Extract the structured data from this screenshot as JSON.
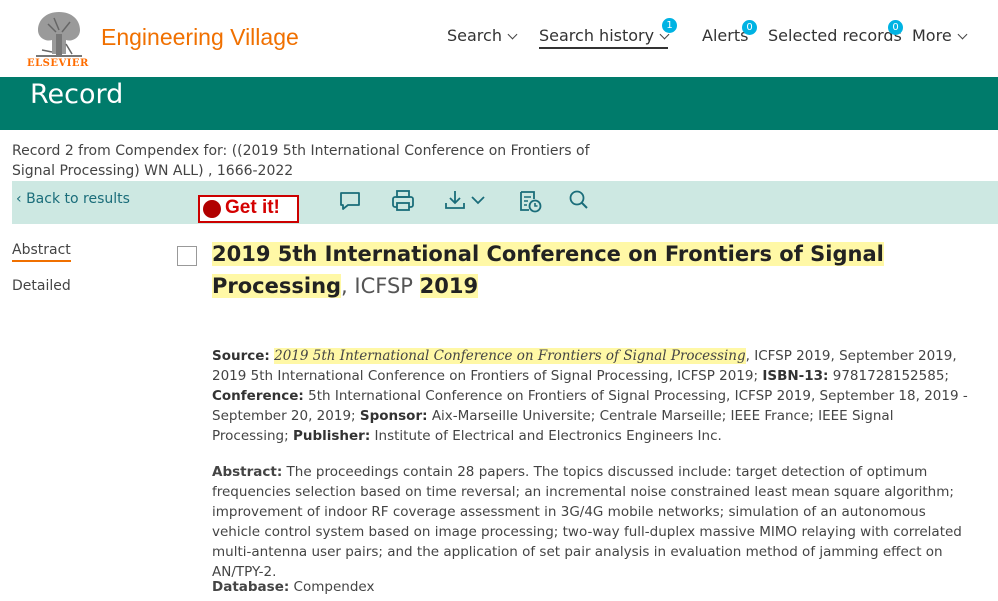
{
  "header": {
    "publisher": "ELSEVIER",
    "brand": "Engineering Village",
    "nav": [
      {
        "label": "Search"
      },
      {
        "label": "Search history",
        "badge": "1"
      },
      {
        "label": "Alerts",
        "badge": "0"
      },
      {
        "label": "Selected records",
        "badge": "0"
      },
      {
        "label": "More"
      }
    ]
  },
  "banner": {
    "title": "Record"
  },
  "record_info": "Record 2 from Compendex for: ((2019 5th International Conference on Frontiers of Signal Processing) WN ALL) , 1666-2022",
  "toolbar": {
    "back_label": "Back to results",
    "getit_label": "Get it!",
    "icons": [
      "comment-icon",
      "print-icon",
      "download-icon",
      "history-icon",
      "search-icon"
    ]
  },
  "sidenav": {
    "abstract": "Abstract",
    "detailed": "Detailed"
  },
  "record": {
    "title_main": "2019 5th International Conference on Frontiers of Signal Processing",
    "title_sep": ", ICFSP ",
    "title_year": "2019",
    "source_label": "Source:",
    "source_title": "2019 5th International Conference on Frontiers of Signal Processing",
    "source_rest": ", ICFSP 2019, September 2019, 2019 5th International Conference on Frontiers of Signal Processing, ICFSP 2019;",
    "isbn_label": "ISBN-13:",
    "isbn": "9781728152585;",
    "conference_label": "Conference:",
    "conference": "5th International Conference on Frontiers of Signal Processing, ICFSP 2019, September 18, 2019 - September 20, 2019;",
    "sponsor_label": "Sponsor:",
    "sponsor": "Aix-Marseille Universite; Centrale Marseille; IEEE France; IEEE Signal Processing;",
    "publisher_label": "Publisher:",
    "publisher": "Institute of Electrical and Electronics Engineers Inc.",
    "abstract_label": "Abstract:",
    "abstract": "The proceedings contain 28 papers. The topics discussed include: target detection of optimum frequencies selection based on time reversal; an incremental noise constrained least mean square algorithm; improvement of indoor RF coverage assessment in 3G/4G mobile networks; simulation of an autonomous vehicle control system based on image processing; two-way full-duplex massive MIMO relaying with correlated multi-antenna user pairs; and the application of set pair analysis in evaluation method of jamming effect on AN/TPY-2.",
    "database_label": "Database:",
    "database": "Compendex"
  },
  "colors": {
    "brand_orange": "#f07000",
    "banner_teal": "#007b6b",
    "toolbar_bg": "#cde8e2",
    "badge_blue": "#00b3e3",
    "highlight": "#fff8a6"
  }
}
